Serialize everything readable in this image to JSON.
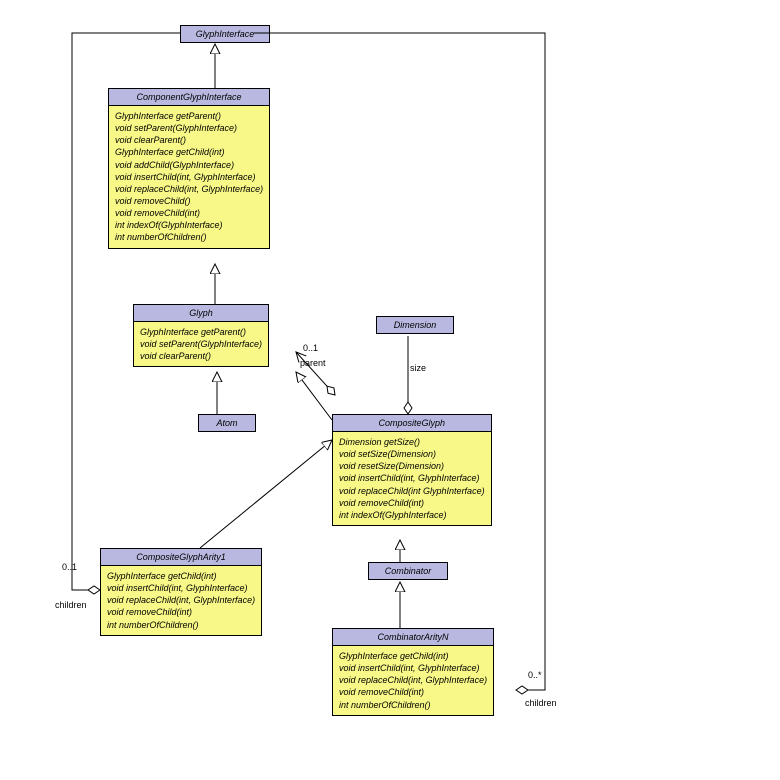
{
  "classes": {
    "glyphinterface": {
      "name": "GlyphInterface"
    },
    "componentglyphinterface": {
      "name": "ComponentGlyphInterface",
      "methods": [
        "GlyphInterface getParent()",
        "void setParent(GlyphInterface)",
        "void clearParent()",
        "GlyphInterface getChild(int)",
        "void addChild(GlyphInterface)",
        "void insertChild(int, GlyphInterface)",
        "void replaceChild(int, GlyphInterface)",
        "void removeChild()",
        "void removeChild(int)",
        "int indexOf(GlyphInterface)",
        "int numberOfChildren()"
      ]
    },
    "glyph": {
      "name": "Glyph",
      "methods": [
        "GlyphInterface getParent()",
        "void setParent(GlyphInterface)",
        "void clearParent()"
      ]
    },
    "atom": {
      "name": "Atom"
    },
    "dimension": {
      "name": "Dimension"
    },
    "compositeglyph": {
      "name": "CompositeGlyph",
      "methods": [
        "Dimension getSize()",
        "void setSize(Dimension)",
        "void resetSize(Dimension)",
        "void insertChild(int, GlyphInterface)",
        "void replaceChild(int GlyphInterface)",
        "void removeChild(int)",
        "int indexOf(GlyphInterface)"
      ]
    },
    "compositeglypharity1": {
      "name": "CompositeGlyphArity1",
      "methods": [
        "GlyphInterface getChild(int)",
        "void insertChild(int, GlyphInterface)",
        "void replaceChild(int, GlyphInterface)",
        "void removeChild(int)",
        "int numberOfChildren()"
      ]
    },
    "combinator": {
      "name": "Combinator"
    },
    "combinatorarityn": {
      "name": "CombinatorArityN",
      "methods": [
        "GlyphInterface getChild(int)",
        "void insertChild(int, GlyphInterface)",
        "void replaceChild(int, GlyphInterface)",
        "void removeChild(int)",
        "int numberOfChildren()"
      ]
    }
  },
  "labels": {
    "parent": "parent",
    "parentMult": "0..1",
    "size": "size",
    "childrenLeft": "children",
    "childrenLeftMult": "0..1",
    "childrenRight": "children",
    "childrenRightMult": "0..*"
  }
}
